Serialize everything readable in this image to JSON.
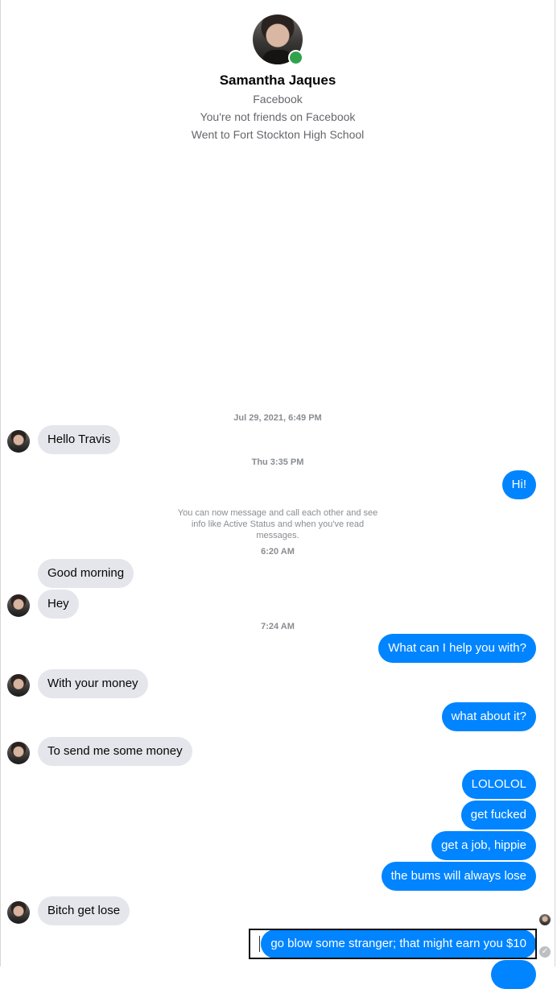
{
  "contact": {
    "name": "Samantha Jaques",
    "source": "Facebook",
    "friend_status": "You're not friends on Facebook",
    "school": "Went to Fort Stockton High School"
  },
  "timestamps": {
    "t1": "Jul 29, 2021, 6:49 PM",
    "t2": "Thu 3:35 PM",
    "t3": "6:20 AM",
    "t4": "7:24 AM"
  },
  "notice": "You can now message and call each other and see info like Active Status and when you've read messages.",
  "messages": {
    "m1": "Hello Travis",
    "m2": "Hi!",
    "m3": "Good morning",
    "m4": "Hey",
    "m5": "What can I help you with?",
    "m6": "With your money",
    "m7": "what about it?",
    "m8": "To send me some money",
    "m9": "LOLOLOL",
    "m10": "get fucked",
    "m11": "get a job, hippie",
    "m12": "the bums will always lose",
    "m13": "Bitch get lose",
    "m14": "go blow some stranger; that might earn you $10"
  },
  "icons": {
    "online": "online-status-dot",
    "seen": "seen-avatar-icon",
    "sent": "sent-check-icon"
  }
}
